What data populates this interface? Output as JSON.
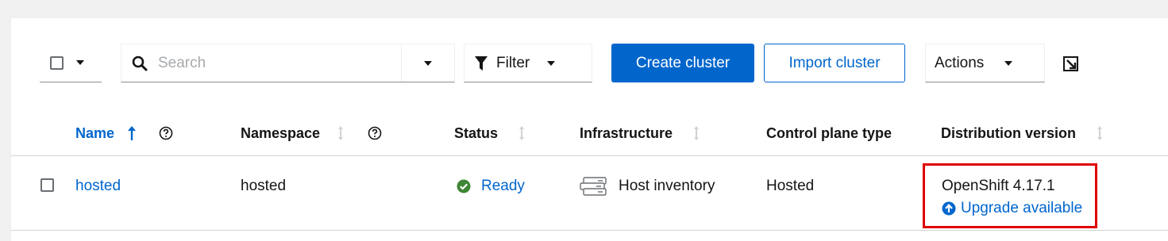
{
  "toolbar": {
    "search_placeholder": "Search",
    "search_value": "",
    "filter_label": "Filter",
    "create_cluster_label": "Create cluster",
    "import_cluster_label": "Import cluster",
    "actions_label": "Actions"
  },
  "table": {
    "columns": [
      {
        "label": "Name",
        "sorted": "ascending",
        "help": true
      },
      {
        "label": "Namespace",
        "sorted": "none",
        "help": true
      },
      {
        "label": "Status",
        "sorted": "none",
        "help": false
      },
      {
        "label": "Infrastructure",
        "sorted": "none",
        "help": false
      },
      {
        "label": "Control plane type",
        "sorted": null,
        "help": false
      },
      {
        "label": "Distribution version",
        "sorted": "none",
        "help": false
      }
    ],
    "rows": [
      {
        "name": "hosted",
        "namespace": "hosted",
        "status": "Ready",
        "infrastructure": "Host inventory",
        "control_plane_type": "Hosted",
        "distribution_version": "OpenShift 4.17.1",
        "upgrade_label": "Upgrade available"
      }
    ]
  },
  "colors": {
    "accent": "#0066cc",
    "success": "#3e8635",
    "highlight": "#e00000"
  },
  "icons": [
    "caret-down-icon",
    "search-icon",
    "filter-icon",
    "manage-columns-icon",
    "sort-asc-icon",
    "sort-icon",
    "help-icon",
    "ready-check-icon",
    "server-icon",
    "upgrade-arrow-icon"
  ]
}
